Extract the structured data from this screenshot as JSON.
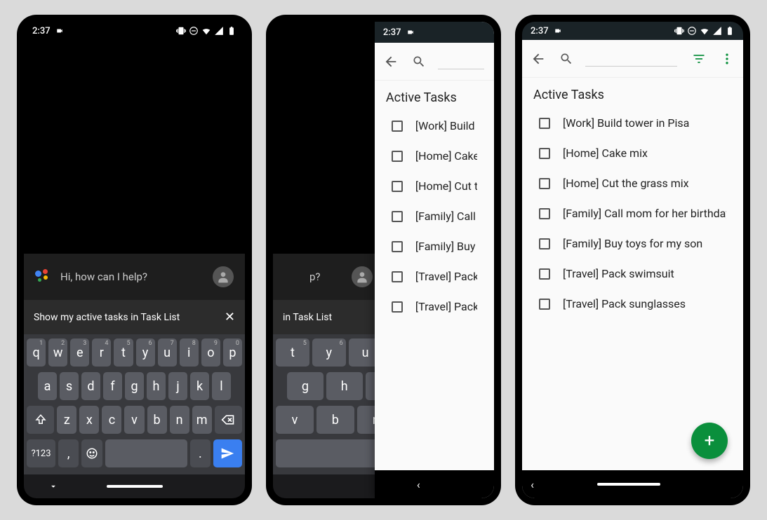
{
  "status": {
    "time": "2:37",
    "icons": [
      "vibrate",
      "dnd",
      "wifi",
      "signal",
      "battery"
    ]
  },
  "assistant": {
    "greeting": "Hi, how can I help?",
    "input": "Show my active tasks in Task List",
    "input_partial": "in Task List"
  },
  "keyboard": {
    "row1": [
      "q",
      "w",
      "e",
      "r",
      "t",
      "y",
      "u",
      "i",
      "o",
      "p"
    ],
    "row1_nums": [
      "1",
      "2",
      "3",
      "4",
      "5",
      "6",
      "7",
      "8",
      "9",
      "0"
    ],
    "row2": [
      "a",
      "s",
      "d",
      "f",
      "g",
      "h",
      "j",
      "k",
      "l"
    ],
    "row3": [
      "z",
      "x",
      "c",
      "v",
      "b",
      "n",
      "m"
    ],
    "row4_symbols": "?123",
    "row4_comma": ",",
    "row4_period": "."
  },
  "tasks": {
    "section_title": "Active Tasks",
    "items": [
      "[Work] Build tower in Pisa",
      "[Home] Cake mix",
      "[Home] Cut the grass mix",
      "[Family] Call mom for her birthday",
      "[Family] Buy toys for my son",
      "[Travel] Pack swimsuit",
      "[Travel] Pack sunglasses"
    ],
    "items_truncated": [
      "[Work] Build t",
      "[Home] Cake",
      "[Home] Cut th",
      "[Family] Call m",
      "[Family] Buy t",
      "[Travel] Pack s",
      "[Travel] Pack s"
    ]
  }
}
